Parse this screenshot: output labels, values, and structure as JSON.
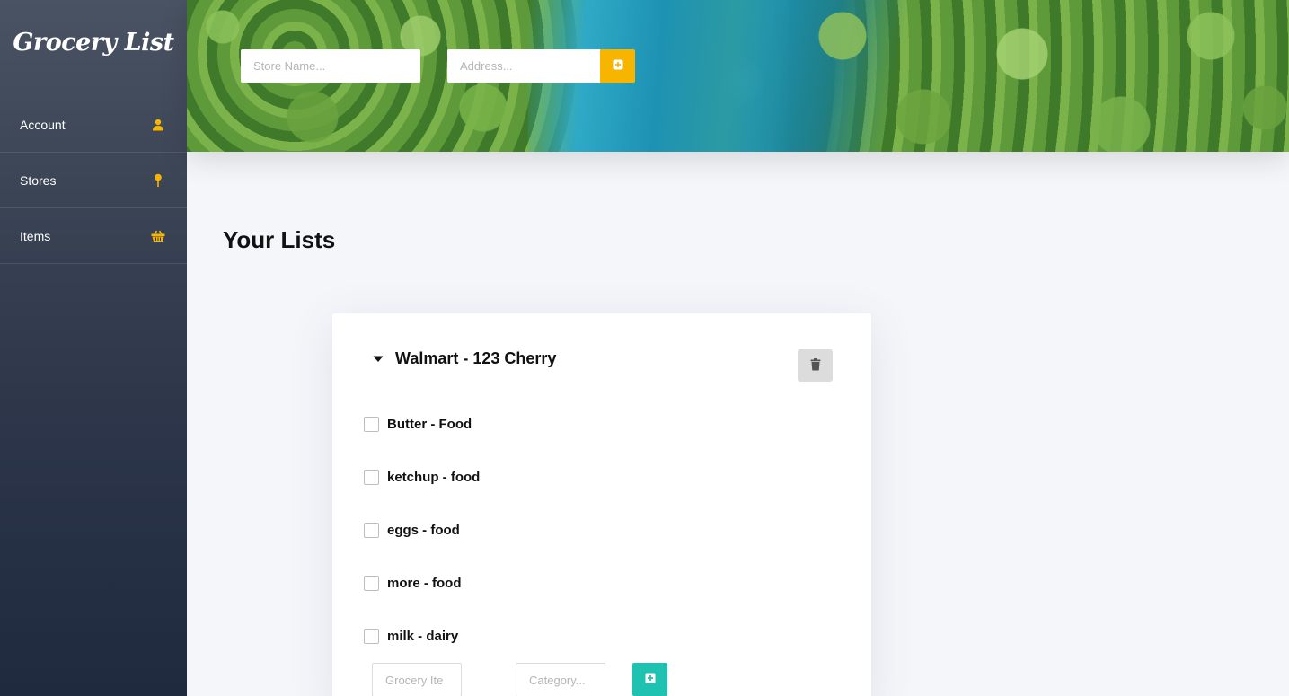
{
  "app": {
    "brand": "Grocery List"
  },
  "sidebar": {
    "items": [
      {
        "label": "Account",
        "icon": "user-icon"
      },
      {
        "label": "Stores",
        "icon": "map-pin-icon"
      },
      {
        "label": "Items",
        "icon": "basket-icon"
      }
    ]
  },
  "header": {
    "store_placeholder": "Store Name...",
    "address_placeholder": "Address...",
    "add_store_icon": "plus-square-icon"
  },
  "main": {
    "title": "Your Lists",
    "list": {
      "title": "Walmart - 123 Cherry",
      "items": [
        {
          "label": "Butter - Food",
          "checked": false
        },
        {
          "label": "ketchup - food",
          "checked": false
        },
        {
          "label": "eggs - food",
          "checked": false
        },
        {
          "label": "more - food",
          "checked": false
        },
        {
          "label": "milk - dairy",
          "checked": false
        }
      ],
      "grocery_placeholder": "Grocery Ite",
      "category_placeholder": "Category...",
      "delete_icon": "trash-icon",
      "add_item_icon": "plus-square-icon"
    }
  },
  "colors": {
    "accent_yellow": "#f7b500",
    "accent_teal": "#1fc1b1",
    "sidebar_top": "#4a5363",
    "sidebar_bottom": "#1f2a3f",
    "page_bg": "#f5f6fa"
  }
}
